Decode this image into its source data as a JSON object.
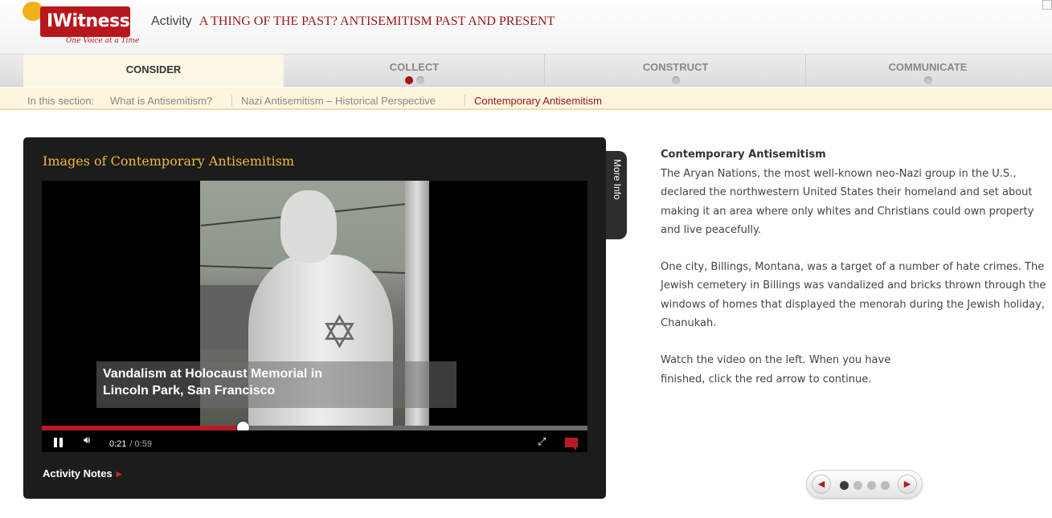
{
  "header": {
    "logo_text": "IWitness",
    "logo_tagline": "One Voice at a Time",
    "activity_word": "Activity",
    "activity_name": "A THING OF THE PAST? ANTISEMITISM PAST AND PRESENT"
  },
  "steps": [
    {
      "label": "CONSIDER",
      "active": true,
      "dots": 0
    },
    {
      "label": "COLLECT",
      "active": false,
      "dots": 2
    },
    {
      "label": "CONSTRUCT",
      "active": false,
      "dots": 1
    },
    {
      "label": "COMMUNICATE",
      "active": false,
      "dots": 1
    }
  ],
  "section_bar": {
    "in_label": "In this section:",
    "sections": [
      {
        "label": "What is Antisemitism?",
        "current": false
      },
      {
        "label": "Nazi Antisemitism – Historical Perspective",
        "current": false
      },
      {
        "label": "Contemporary Antisemitism",
        "current": true
      }
    ]
  },
  "panel": {
    "title": "Images of Contemporary Antisemitism",
    "more_info": "More Info",
    "activity_notes": "Activity Notes",
    "video": {
      "caption_line1": "Vandalism at Holocaust Memorial in",
      "caption_line2": "Lincoln Park, San Francisco",
      "current_time": "0:21",
      "duration": "/ 0:59",
      "progress": 0.368
    }
  },
  "content": {
    "heading": "Contemporary Antisemitism",
    "p1": "The Aryan Nations, the most well-known neo-Nazi group in the U.S., declared the northwestern United States their homeland and set about making it an area where only whites and Christians could own property and live peacefully.",
    "p2": "One city, Billings, Montana, was a target of a number of hate crimes. The Jewish cemetery in Billings was vandalized and bricks thrown through the windows of homes that displayed the menorah during the Jewish holiday, Chanukah.",
    "p3_line1": "Watch the video on the left. When you have",
    "p3_line2": "finished, click the red arrow to continue."
  },
  "pager": {
    "total": 4,
    "current": 1
  },
  "colors": {
    "brand_red": "#9a1419",
    "title_gold": "#f2b93b",
    "panel_bg": "#1c1c1c"
  }
}
